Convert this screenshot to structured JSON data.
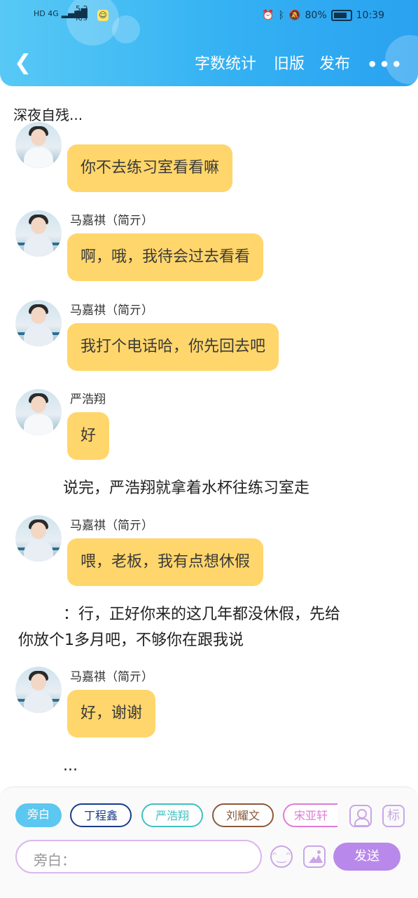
{
  "status_bar": {
    "signal": "HD 4G",
    "net_speed_value": "5.2",
    "net_speed_unit": "K/s",
    "battery": "80%",
    "time": "10:39"
  },
  "header": {
    "back_icon": "chevron-left-icon",
    "word_count": "字数统计",
    "old_version": "旧版",
    "publish": "发布",
    "more": "•••"
  },
  "story_title": "深夜自残...",
  "messages": [
    {
      "speaker": "",
      "text": "你不去练习室看看嘛"
    },
    {
      "speaker": "马嘉祺（简亓）",
      "text": "啊，哦，我待会过去看看"
    },
    {
      "speaker": "马嘉祺（简亓）",
      "text": "我打个电话哈，你先回去吧"
    },
    {
      "speaker": "严浩翔",
      "text": "好"
    },
    {
      "speaker": "马嘉祺（简亓）",
      "text": "喂，老板，我有点想休假"
    },
    {
      "speaker": "马嘉祺（简亓）",
      "text": "好，谢谢"
    }
  ],
  "narrations": [
    "说完，严浩翔就拿着水杯往练习室走",
    "：行，正好你来的这几年都没休假，先给",
    "你放个1多月吧，不够你在跟我说",
    "..."
  ],
  "roles": [
    {
      "label": "旁白",
      "color": "#5cc7f0"
    },
    {
      "label": "丁程鑫",
      "color": "#1b3c8a"
    },
    {
      "label": "严浩翔",
      "color": "#3fc1c0"
    },
    {
      "label": "刘耀文",
      "color": "#8a5a3a"
    },
    {
      "label": "宋亚轩",
      "color": "#e07ad8"
    }
  ],
  "composer": {
    "placeholder": "旁白：",
    "send": "发送",
    "tag_icon_label": "标"
  }
}
